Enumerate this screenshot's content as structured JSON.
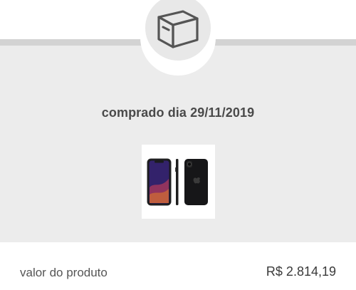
{
  "header": {
    "icon": "box-icon"
  },
  "order": {
    "purchase_date_text": "comprado dia 29/11/2019",
    "product_image_icon": "smartphone-product-image"
  },
  "summary": {
    "value_label": "valor do produto",
    "value_amount": "R$ 2.814,19"
  },
  "colors": {
    "panel_background": "#ececec",
    "panel_border": "#d3d3d3",
    "icon_circle": "#e8e8e8",
    "text_primary": "#4a4a4a"
  }
}
